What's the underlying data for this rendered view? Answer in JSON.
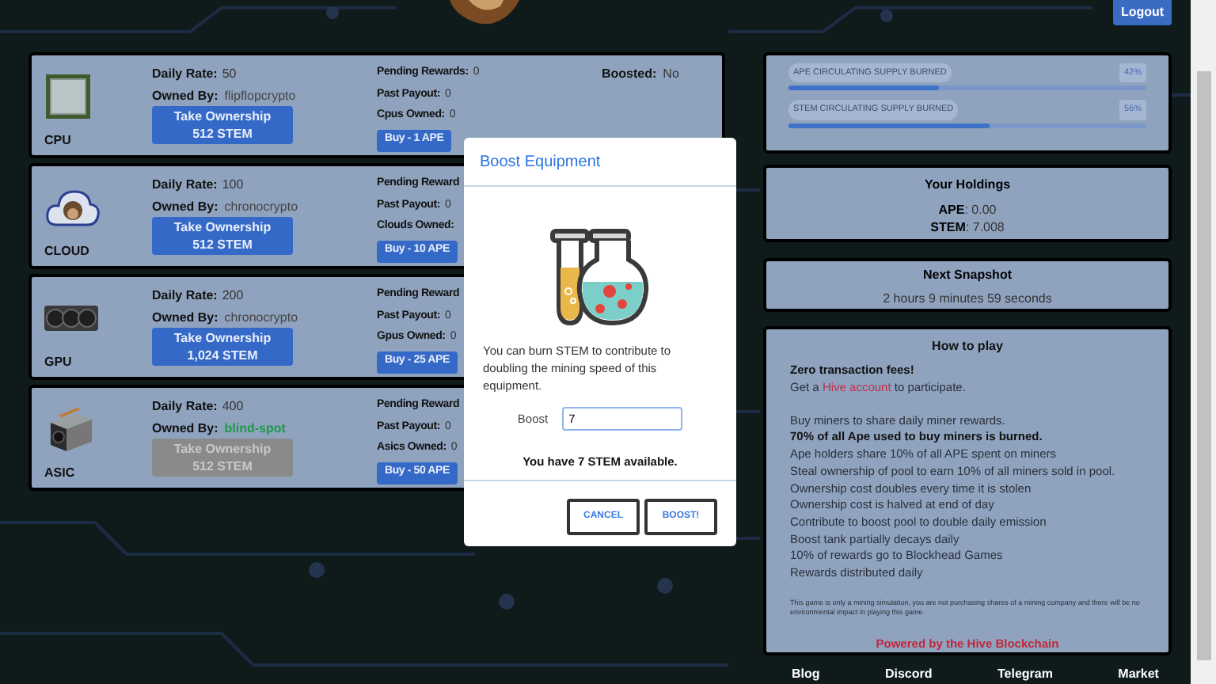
{
  "header": {
    "logout": "Logout"
  },
  "equipment": [
    {
      "kind": "cpu",
      "name": "CPU",
      "daily_rate_label": "Daily Rate:",
      "daily_rate": "50",
      "owned_by_label": "Owned By:",
      "owner": "flipflopcrypto",
      "owned": false,
      "take_ownership": [
        "Take Ownership",
        "512 STEM"
      ],
      "stats": [
        {
          "label": "Pending Rewards:",
          "value": "0"
        },
        {
          "label": "Past Payout:",
          "value": "0"
        },
        {
          "label": "Cpus Owned:",
          "value": "0"
        }
      ],
      "buy": "Buy - 1 APE",
      "boosted": {
        "label": "Boosted:",
        "value": "No"
      }
    },
    {
      "kind": "cloud",
      "name": "CLOUD",
      "daily_rate_label": "Daily Rate:",
      "daily_rate": "100",
      "owned_by_label": "Owned By:",
      "owner": "chronocrypto",
      "owned": false,
      "take_ownership": [
        "Take Ownership",
        "512 STEM"
      ],
      "stats": [
        {
          "label": "Pending Reward"
        },
        {
          "label": "Past Payout:",
          "value": "0"
        },
        {
          "label": "Clouds Owned:"
        }
      ],
      "buy": "Buy - 10 APE"
    },
    {
      "kind": "gpu",
      "name": "GPU",
      "daily_rate_label": "Daily Rate:",
      "daily_rate": "200",
      "owned_by_label": "Owned By:",
      "owner": "chronocrypto",
      "owned": false,
      "take_ownership": [
        "Take Ownership",
        "1,024 STEM"
      ],
      "stats": [
        {
          "label": "Pending Reward"
        },
        {
          "label": "Past Payout:",
          "value": "0"
        },
        {
          "label": "Gpus Owned:",
          "value": "0"
        }
      ],
      "buy": "Buy - 25 APE"
    },
    {
      "kind": "asic",
      "name": "ASIC",
      "daily_rate_label": "Daily Rate:",
      "daily_rate": "400",
      "owned_by_label": "Owned By:",
      "owner": "blind-spot",
      "owned": true,
      "take_ownership": [
        "Take Ownership",
        "512 STEM"
      ],
      "stats": [
        {
          "label": "Pending Reward"
        },
        {
          "label": "Past Payout:",
          "value": "0"
        },
        {
          "label": "Asics Owned:",
          "value": "0"
        }
      ],
      "buy": "Buy - 50 APE"
    }
  ],
  "burn_meters": [
    {
      "label": "APE CIRCULATING SUPPLY BURNED",
      "reading": "42%",
      "level": 0.42
    },
    {
      "label": "STEM CIRCULATING SUPPLY BURNED",
      "reading": "56%",
      "level": 0.56
    }
  ],
  "holdings": {
    "title": "Your Holdings",
    "items": [
      {
        "label": "APE",
        "value": ": 0.00"
      },
      {
        "label": "STEM",
        "value": ": 7.008"
      }
    ]
  },
  "snapshot": {
    "title": "Next Snapshot",
    "countdown": "2 hours 9 minutes 59 seconds"
  },
  "how_to_play": {
    "title": "How to play",
    "lines": [
      {
        "kind": "bold",
        "text": "Zero transaction fees!"
      },
      {
        "kind": "link",
        "before": "Get a ",
        "link": "Hive account",
        "after": " to participate."
      },
      {
        "kind": "gap"
      },
      {
        "kind": "plain",
        "text": "Buy miners to share daily miner rewards."
      },
      {
        "kind": "bold",
        "text": "70% of all Ape used to buy miners is burned."
      },
      {
        "kind": "plain",
        "text": "Ape holders share 10% of all APE spent on miners"
      },
      {
        "kind": "plain",
        "text": "Steal ownership of pool to earn 10% of all miners sold in pool."
      },
      {
        "kind": "plain",
        "text": "Ownership cost doubles every time it is stolen"
      },
      {
        "kind": "plain",
        "text": "Ownership cost is halved at end of day"
      },
      {
        "kind": "plain",
        "text": "Contribute to boost pool to double daily emission"
      },
      {
        "kind": "plain",
        "text": "Boost tank partially decays daily"
      },
      {
        "kind": "plain",
        "text": "10% of rewards go to Blockhead Games"
      },
      {
        "kind": "plain",
        "text": "Rewards distributed daily"
      }
    ],
    "disclaimer": "This game is only a mining simulation, you are not purchasing shares of a mining company and there will be no environmental impact in playing this game",
    "powered_by": "Powered by the Hive Blockchain"
  },
  "footer_links": [
    "Blog",
    "Discord",
    "Telegram",
    "Market"
  ],
  "modal": {
    "title": "Boost Equipment",
    "description": "You can burn STEM to contribute to doubling the mining speed of this equipment.",
    "field_label": "Boost",
    "field_value": "7",
    "available": "You have 7 STEM available.",
    "buttons": [
      "CANCEL",
      "BOOST!"
    ]
  }
}
